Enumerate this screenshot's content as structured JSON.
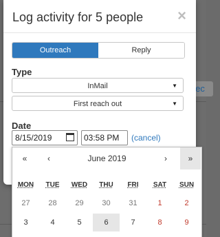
{
  "modal": {
    "title": "Log activity for 5 people",
    "close_symbol": "×"
  },
  "activity_toggle": {
    "options": [
      "Outreach",
      "Reply"
    ],
    "selected": "Outreach"
  },
  "type_section": {
    "label": "Type",
    "channel_value": "InMail",
    "stage_value": "First reach out"
  },
  "date_section": {
    "label": "Date",
    "date_value": "8/15/2019",
    "time_value": "03:58 PM",
    "cancel_label": "(cancel)"
  },
  "datepicker": {
    "prev_year": "«",
    "prev_month": "‹",
    "month_label": "June 2019",
    "next_month": "›",
    "next_year": "»",
    "weekdays": [
      "MON",
      "TUE",
      "WED",
      "THU",
      "FRI",
      "SAT",
      "SUN"
    ],
    "week1": [
      "27",
      "28",
      "29",
      "30",
      "31",
      "1",
      "2"
    ],
    "week2": [
      "3",
      "4",
      "5",
      "6",
      "7",
      "8",
      "9"
    ]
  },
  "background": {
    "partial_link_text": "elec"
  },
  "colors": {
    "accent": "#2f79bd",
    "weekend": "#c0392b",
    "today_bg": "#e6e6e6"
  }
}
